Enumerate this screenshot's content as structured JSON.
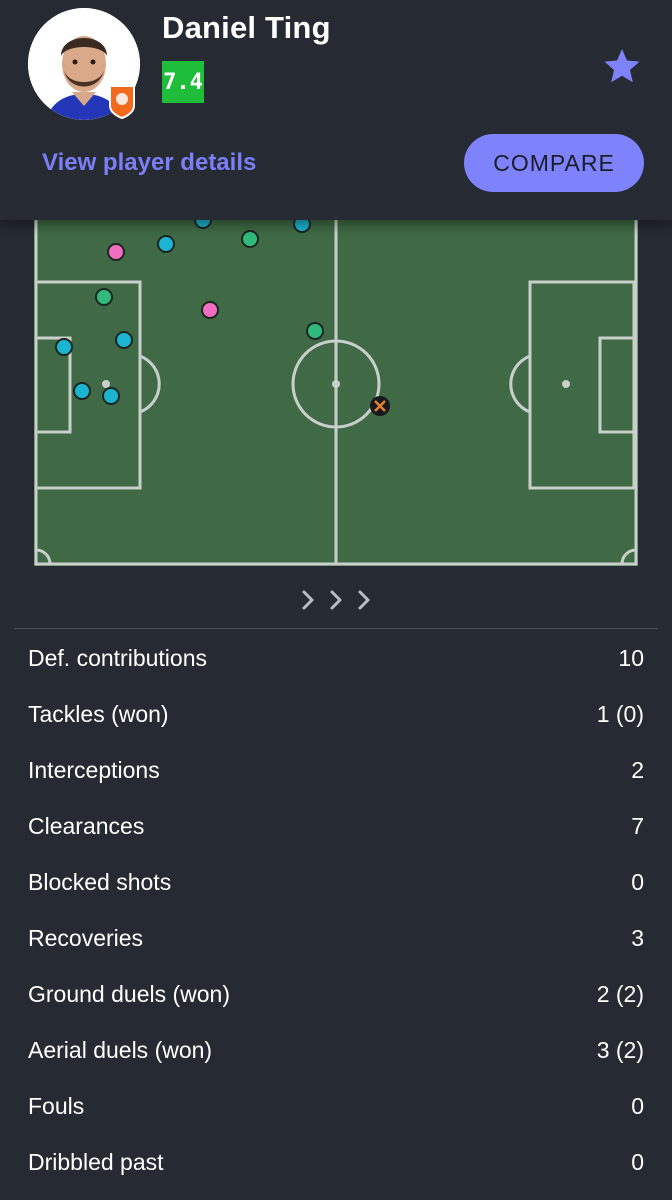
{
  "player": {
    "name": "Daniel Ting",
    "rating": "7.4"
  },
  "colors": {
    "accent": "#7e82fb",
    "rating_bg": "#1fbe3a",
    "pitch": "#3f6a45",
    "dot_interception": "#1bb5d1",
    "dot_clearance": "#2fb97a",
    "dot_recovery": "#f06ec0",
    "dribbled_marker": "#e8822a"
  },
  "actions": {
    "view_details": "View player details",
    "compare": "COMPARE"
  },
  "icons": {
    "favorite": "star-icon",
    "next": "chevron-right-icon"
  },
  "stats": [
    {
      "label": "Def. contributions",
      "value": "10"
    },
    {
      "label": "Tackles (won)",
      "value": "1 (0)"
    },
    {
      "label": "Interceptions",
      "value": "2"
    },
    {
      "label": "Clearances",
      "value": "7"
    },
    {
      "label": "Blocked shots",
      "value": "0"
    },
    {
      "label": "Recoveries",
      "value": "3"
    },
    {
      "label": "Ground duels (won)",
      "value": "2 (2)"
    },
    {
      "label": "Aerial duels (won)",
      "value": "3 (2)"
    },
    {
      "label": "Fouls",
      "value": "0"
    },
    {
      "label": "Dribbled past",
      "value": "0"
    }
  ]
}
